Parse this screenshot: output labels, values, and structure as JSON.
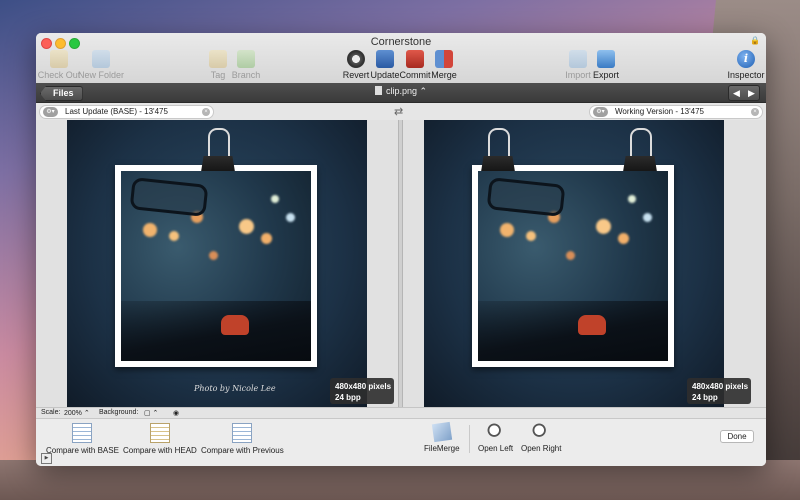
{
  "window": {
    "title": "Cornerstone"
  },
  "toolbar": {
    "check_out": "Check Out",
    "new_folder": "New Folder",
    "tag": "Tag",
    "branch": "Branch",
    "revert": "Revert",
    "update": "Update",
    "commit": "Commit",
    "merge": "Merge",
    "import": "Import",
    "export": "Export",
    "inspector": "Inspector"
  },
  "navbar": {
    "files": "Files",
    "file_name": "clip.png ⌃",
    "prev": "◀",
    "next": "▶"
  },
  "versions": {
    "left": "Last Update (BASE) - 13'475",
    "right": "Working Version - 13'475",
    "selector": "⚙▾",
    "clear": "×",
    "swap": "⇄"
  },
  "left_pane": {
    "credit": "Photo by Nicole Lee",
    "size": "480x480 pixels",
    "depth": "24 bpp"
  },
  "right_pane": {
    "size": "480x480 pixels",
    "depth": "24 bpp"
  },
  "status": {
    "scale_label": "Scale:",
    "scale_value": "200% ⌃",
    "background_label": "Background:",
    "bg_choice_1": "▢ ⌃",
    "bg_choice_2": "◉"
  },
  "bottom": {
    "compare_base": "Compare with BASE",
    "compare_head": "Compare with HEAD",
    "compare_prev": "Compare with Previous",
    "filemerge": "FileMerge",
    "open_left": "Open Left",
    "open_right": "Open Right",
    "done": "Done",
    "toggle": "▶"
  },
  "colors": {
    "accent": "#2f6db5",
    "desktop_top": "#3d4f86",
    "desktop_mid": "#e8a88f"
  }
}
